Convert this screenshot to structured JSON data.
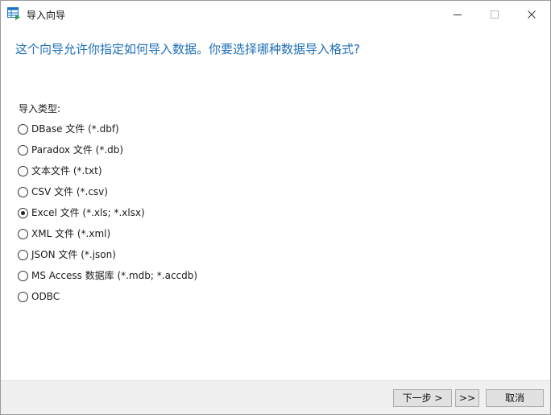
{
  "window": {
    "title": "导入向导",
    "icon": "import-wizard-icon"
  },
  "header": {
    "question": "这个向导允许你指定如何导入数据。你要选择哪种数据导入格式?"
  },
  "import_types": {
    "label": "导入类型:",
    "selected": "Excel 文件 (*.xls; *.xlsx)",
    "options": [
      {
        "label": "DBase 文件 (*.dbf)",
        "checked": false
      },
      {
        "label": "Paradox 文件 (*.db)",
        "checked": false
      },
      {
        "label": "文本文件 (*.txt)",
        "checked": false
      },
      {
        "label": "CSV 文件 (*.csv)",
        "checked": false
      },
      {
        "label": "Excel 文件 (*.xls; *.xlsx)",
        "checked": true
      },
      {
        "label": "XML 文件 (*.xml)",
        "checked": false
      },
      {
        "label": "JSON 文件 (*.json)",
        "checked": false
      },
      {
        "label": "MS Access 数据库 (*.mdb; *.accdb)",
        "checked": false
      },
      {
        "label": "ODBC",
        "checked": false
      }
    ]
  },
  "footer": {
    "next_label": "下一步 >",
    "last_label": ">>",
    "cancel_label": "取消"
  },
  "colors": {
    "header_text": "#1f6fb8",
    "footer_bg": "#f0f0f0",
    "button_bg": "#e1e1e1",
    "icon_accent": "#1a73c9",
    "icon_green": "#2e9e4f"
  }
}
